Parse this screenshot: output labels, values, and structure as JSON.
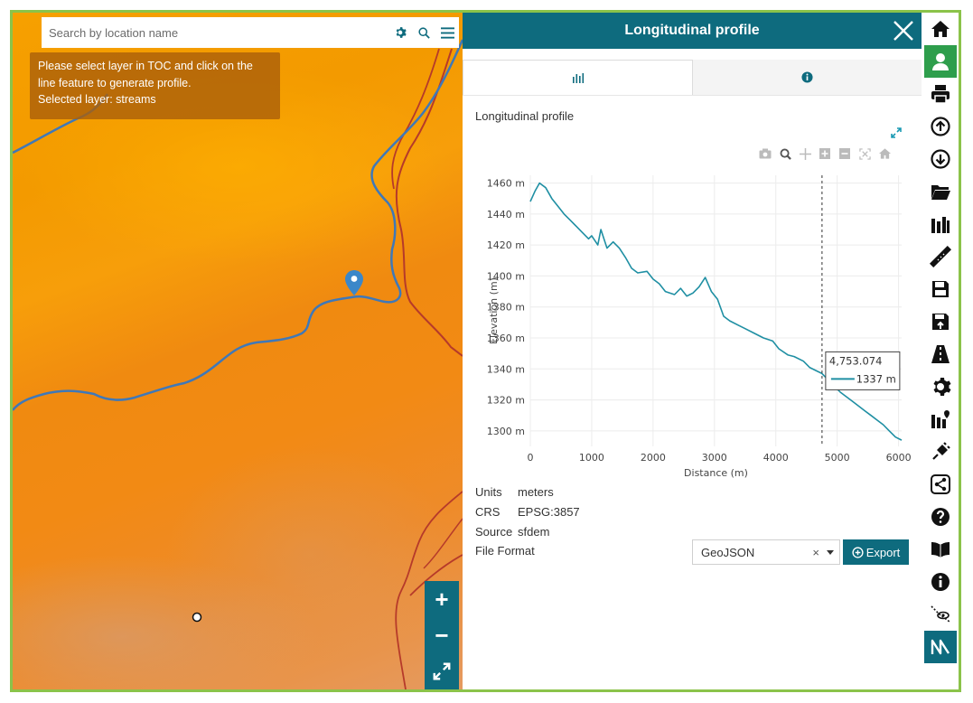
{
  "search": {
    "placeholder": "Search by location name"
  },
  "map_tooltip": {
    "line1": "Please select layer in TOC and click on the",
    "line2": "line feature to generate profile.",
    "line3": "Selected layer: streams"
  },
  "panel": {
    "title": "Longitudinal profile",
    "section_title": "Longitudinal profile",
    "tabs": [
      {
        "icon": "bar-chart-icon",
        "active": true
      },
      {
        "icon": "info-icon",
        "active": false
      }
    ]
  },
  "chart_data": {
    "type": "line",
    "xlabel": "Distance (m)",
    "ylabel": "Elevation (m)",
    "xlim": [
      0,
      6050
    ],
    "ylim": [
      1290,
      1465
    ],
    "x_ticks": [
      0,
      1000,
      2000,
      3000,
      4000,
      5000,
      6000
    ],
    "x_tick_labels": [
      "0",
      "1000",
      "2000",
      "3000",
      "4000",
      "5000",
      "6000"
    ],
    "y_ticks": [
      1300,
      1320,
      1340,
      1360,
      1380,
      1400,
      1420,
      1440,
      1460
    ],
    "y_tick_labels": [
      "1300 m",
      "1320 m",
      "1340 m",
      "1360 m",
      "1380 m",
      "1400 m",
      "1420 m",
      "1440 m",
      "1460 m"
    ],
    "grid": true,
    "series": [
      {
        "color": "#1f8fa3",
        "x": [
          0,
          80,
          150,
          250,
          350,
          450,
          550,
          650,
          750,
          850,
          950,
          1000,
          1100,
          1150,
          1250,
          1350,
          1450,
          1550,
          1650,
          1750,
          1900,
          2000,
          2100,
          2200,
          2350,
          2450,
          2550,
          2650,
          2750,
          2850,
          2950,
          3050,
          3150,
          3250,
          3400,
          3500,
          3650,
          3800,
          3950,
          4050,
          4200,
          4300,
          4450,
          4550,
          4650,
          4753,
          4850,
          4950,
          5050,
          5150,
          5250,
          5350,
          5450,
          5550,
          5650,
          5750,
          5850,
          5950,
          6050
        ],
        "y": [
          1448,
          1455,
          1460,
          1457,
          1450,
          1445,
          1440,
          1436,
          1432,
          1428,
          1424,
          1426,
          1420,
          1430,
          1418,
          1422,
          1418,
          1412,
          1405,
          1402,
          1403,
          1398,
          1395,
          1390,
          1388,
          1392,
          1387,
          1389,
          1393,
          1399,
          1390,
          1385,
          1374,
          1371,
          1368,
          1366,
          1363,
          1360,
          1358,
          1353,
          1349,
          1348,
          1345,
          1341,
          1339,
          1337,
          1333,
          1329,
          1325,
          1322,
          1319,
          1316,
          1313,
          1310,
          1307,
          1304,
          1300,
          1296,
          1294
        ]
      }
    ],
    "hover": {
      "x_label": "4,753.074",
      "value_label": "1337 m",
      "x": 4753
    }
  },
  "meta": {
    "units_label": "Units",
    "units_value": "meters",
    "crs_label": "CRS",
    "crs_value": "EPSG:3857",
    "source_label": "Source",
    "source_value": "sfdem",
    "file_format_label": "File Format"
  },
  "export": {
    "format_value": "GeoJSON",
    "clear_symbol": "×",
    "button_label": "Export"
  },
  "map_controls": {
    "zoom_in": "+",
    "zoom_out": "−"
  },
  "toolbar": [
    "home-icon",
    "user-icon",
    "print-icon",
    "upload-icon",
    "download-icon",
    "folder-open-icon",
    "library-icon",
    "ruler-icon",
    "save-icon",
    "save-as-icon",
    "road-icon",
    "gear-icon",
    "map-marker-icon",
    "plug-icon",
    "share-icon",
    "help-icon",
    "book-icon",
    "info-icon",
    "route-eye-icon",
    "profile-line-icon"
  ],
  "colors": {
    "teal": "#0e6b7e",
    "green_active": "#2e9e4c",
    "frame_green": "#8bc34a"
  }
}
